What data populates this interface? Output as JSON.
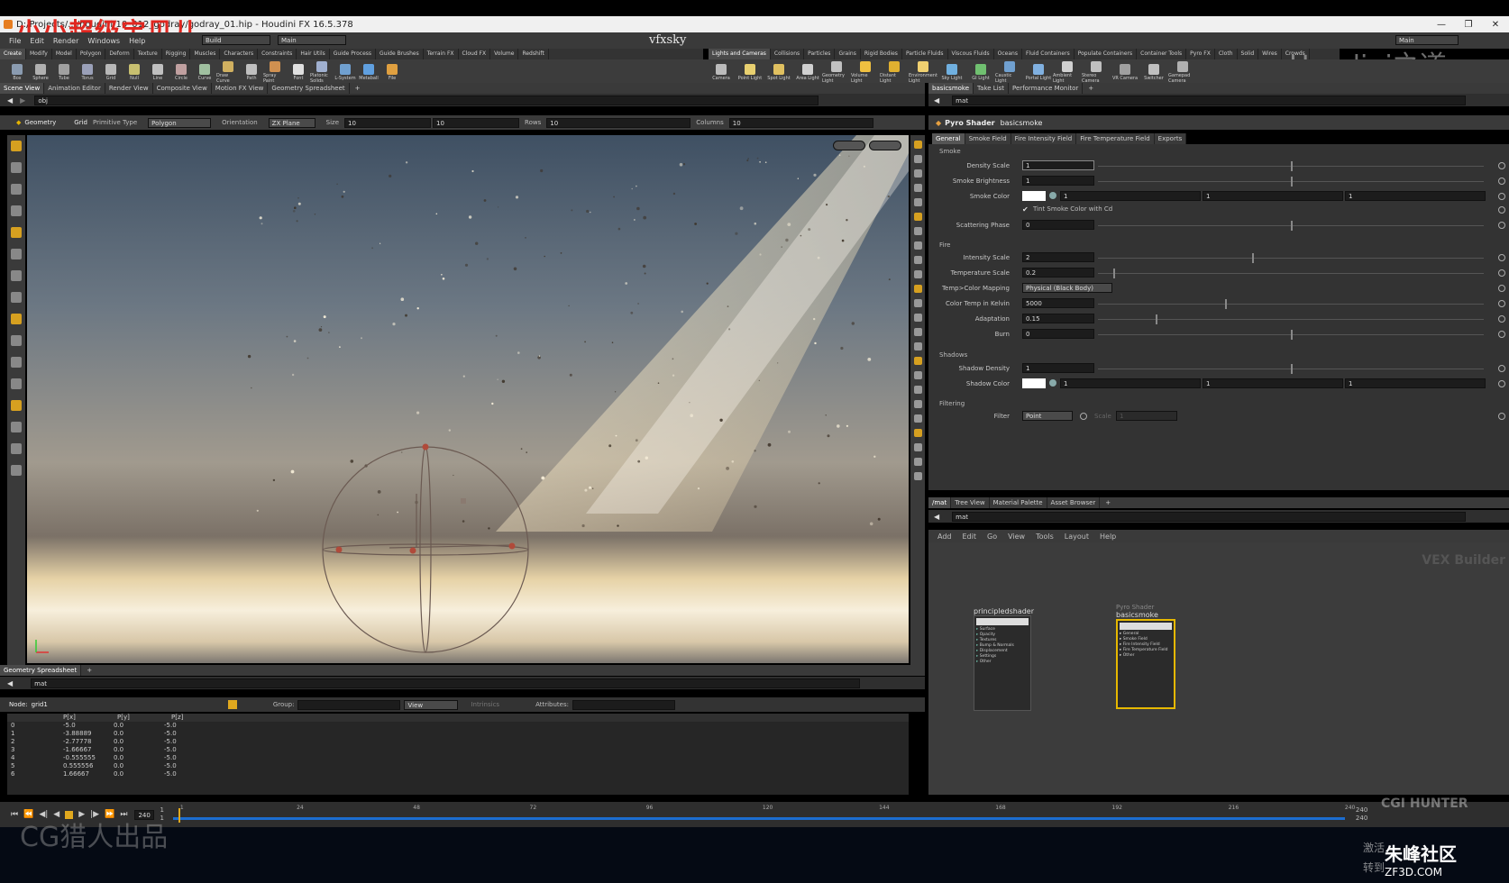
{
  "watermark_tl": "小小超级宝贝儿",
  "window_title": "D:/Projects/.../houdini/10_012_godray/godray_01.hip - Houdini FX 16.5.378",
  "window_controls": [
    "—",
    "❐",
    "✕"
  ],
  "menubar": {
    "items": [
      "File",
      "Edit",
      "Render",
      "Windows",
      "Help"
    ],
    "build_label": "Build",
    "desktop_label": "Main",
    "center_brand": "vfxsky",
    "right_desktop": "Main"
  },
  "shelf_tabs_left": [
    "Create",
    "Modify",
    "Model",
    "Polygon",
    "Deform",
    "Texture",
    "Rigging",
    "Muscles",
    "Characters",
    "Constraints",
    "Hair Utils",
    "Guide Process",
    "Guide Brushes",
    "Terrain FX",
    "Cloud FX",
    "Volume",
    "Redshift"
  ],
  "shelf_tabs_right": [
    "Lights and Cameras",
    "Collisions",
    "Particles",
    "Grains",
    "Rigid Bodies",
    "Particle Fluids",
    "Viscous Fluids",
    "Oceans",
    "Fluid Containers",
    "Populate Containers",
    "Container Tools",
    "Pyro FX",
    "Cloth",
    "Solid",
    "Wires",
    "Crowds"
  ],
  "shelf_tools_left": [
    "Box",
    "Sphere",
    "Tube",
    "Torus",
    "Grid",
    "Null",
    "Line",
    "Circle",
    "Curve",
    "Draw Curve",
    "Path",
    "Spray Paint",
    "Font",
    "Platonic Solids",
    "L-System",
    "Metaball",
    "File"
  ],
  "shelf_tools_right": [
    "Camera",
    "Point Light",
    "Spot Light",
    "Area Light",
    "Geometry Light",
    "Volume Light",
    "Distant Light",
    "Environment Light",
    "Sky Light",
    "GI Light",
    "Caustic Light",
    "Portal Light",
    "Ambient Light",
    "Stereo Camera",
    "VR Camera",
    "Switcher",
    "Gamepad Camera"
  ],
  "houdini_logo": "Houdini之道",
  "left_pane": {
    "tabs": [
      "Scene View",
      "Animation Editor",
      "Render View",
      "Composite View",
      "Motion FX View",
      "Geometry Spreadsheet"
    ],
    "path": "obj",
    "toolbar": {
      "geometry": "Geometry",
      "grid": "Grid",
      "primitive_type_label": "Primitive Type",
      "primitive_type": "Polygon",
      "orientation_label": "Orientation",
      "orientation": "ZX Plane",
      "size_label": "Size",
      "size_x": "10",
      "size_y": "10",
      "rows_label": "Rows",
      "rows": "10",
      "columns_label": "Columns",
      "columns": "10"
    },
    "viewport": {
      "persp": "Persp▾",
      "cam": "Cam1▾"
    }
  },
  "spreadsheet": {
    "tab": "Geometry Spreadsheet",
    "path": "mat",
    "group_label": "Group:",
    "view_label": "View",
    "intrinsics_label": "Intrinsics",
    "attributes_label": "Attributes:",
    "node_label": "Node:",
    "node": "grid1",
    "headers": [
      "",
      "P[x]",
      "P[y]",
      "P[z]"
    ],
    "rows": [
      [
        "0",
        "-5.0",
        "0.0",
        "-5.0"
      ],
      [
        "1",
        "-3.88889",
        "0.0",
        "-5.0"
      ],
      [
        "2",
        "-2.77778",
        "0.0",
        "-5.0"
      ],
      [
        "3",
        "-1.66667",
        "0.0",
        "-5.0"
      ],
      [
        "4",
        "-0.555555",
        "0.0",
        "-5.0"
      ],
      [
        "5",
        "0.555556",
        "0.0",
        "-5.0"
      ],
      [
        "6",
        "1.66667",
        "0.0",
        "-5.0"
      ]
    ]
  },
  "right_pane": {
    "tabs": [
      "basicsmoke",
      "Take List",
      "Performance Monitor"
    ],
    "path": "mat",
    "shader_type": "Pyro Shader",
    "shader_name": "basicsmoke",
    "param_tabs": [
      "General",
      "Smoke Field",
      "Fire Intensity Field",
      "Fire Temperature Field",
      "Exports"
    ],
    "sections": {
      "smoke": "Smoke",
      "fire": "Fire",
      "shadows": "Shadows",
      "filtering": "Filtering"
    },
    "params": {
      "density_scale": {
        "label": "Density Scale",
        "value": "1",
        "fill": 0.5
      },
      "smoke_brightness": {
        "label": "Smoke Brightness",
        "value": "1",
        "fill": 0.5
      },
      "smoke_color": {
        "label": "Smoke Color",
        "r": "1",
        "g": "1",
        "b": "1"
      },
      "tint": {
        "label": "Tint Smoke Color with Cd"
      },
      "scattering_phase": {
        "label": "Scattering Phase",
        "value": "0",
        "fill": 0.5
      },
      "intensity_scale": {
        "label": "Intensity Scale",
        "value": "2",
        "fill": 0.4
      },
      "temperature_scale": {
        "label": "Temperature Scale",
        "value": "0.2",
        "fill": 0.04
      },
      "mapping": {
        "label": "Temp>Color Mapping",
        "value": "Physical (Black Body)"
      },
      "color_temp": {
        "label": "Color Temp in Kelvin",
        "value": "5000",
        "fill": 0.33
      },
      "adaptation": {
        "label": "Adaptation",
        "value": "0.15",
        "fill": 0.15
      },
      "burn": {
        "label": "Burn",
        "value": "0",
        "fill": 0.5
      },
      "shadow_density": {
        "label": "Shadow Density",
        "value": "1",
        "fill": 0.5
      },
      "shadow_color": {
        "label": "Shadow Color",
        "r": "1",
        "g": "1",
        "b": "1"
      },
      "filter": {
        "label": "Filter",
        "value": "Point",
        "scale_label": "Scale",
        "scale_value": "1"
      }
    }
  },
  "network": {
    "tabs": [
      "/mat",
      "Tree View",
      "Material Palette",
      "Asset Browser"
    ],
    "path": "mat",
    "menu": [
      "Add",
      "Edit",
      "Go",
      "View",
      "Tools",
      "Layout",
      "Help"
    ],
    "builder_label": "VEX Builder",
    "node1": {
      "name": "principledshader",
      "inputs": [
        "Surface",
        "Opacity",
        "Textures",
        "Bump & Normals",
        "Displacement",
        "Settings",
        "Other"
      ]
    },
    "node2": {
      "type": "Pyro Shader",
      "name": "basicsmoke",
      "inputs": [
        "General",
        "Smoke Field",
        "Fire Intensity Field",
        "Fire Temperature Field",
        "Other"
      ]
    }
  },
  "timeline": {
    "frame": "1",
    "start": "1",
    "end": "240",
    "end2": "240",
    "ticks": [
      "1",
      "24",
      "48",
      "72",
      "96",
      "120",
      "144",
      "168",
      "192",
      "216",
      "240"
    ]
  },
  "bottom": {
    "cg_watermark": "CG猎人出品",
    "zf_watermark": "朱峰社区",
    "zf_url": "ZF3D.COM",
    "cgi_label": "CGI HUNTER",
    "cn_text_1": "激活",
    "cn_text_2": "转到"
  }
}
